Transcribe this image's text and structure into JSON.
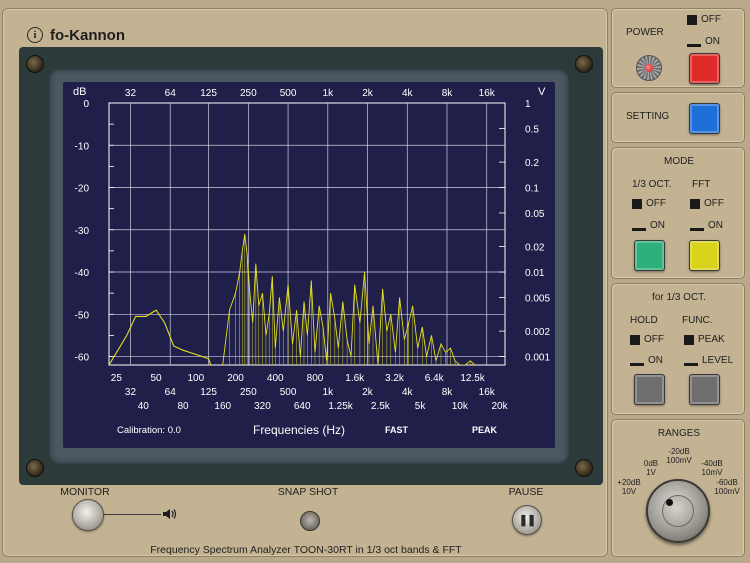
{
  "app": {
    "title": "fo-Kannon",
    "info_icon": "i"
  },
  "chart_data": {
    "type": "line",
    "title": "",
    "xlabel": "Frequencies (Hz)",
    "ylabel": "dB",
    "ylabel_right": "V",
    "ylim": [
      -62,
      0
    ],
    "x_scale": "log",
    "xlim": [
      22,
      22000
    ],
    "y_ticks_left": [
      "0",
      "-10",
      "-20",
      "-30",
      "-40",
      "-50",
      "-60"
    ],
    "y_ticks_right": [
      "1",
      "0.5",
      "0.2",
      "0.1",
      "0.05",
      "0.02",
      "0.01",
      "0.005",
      "0.002",
      "0.001"
    ],
    "x_ticks_top": [
      "32",
      "64",
      "125",
      "250",
      "500",
      "1k",
      "2k",
      "4k",
      "8k",
      "16k"
    ],
    "x_ticks_bottom_row1": [
      "25",
      "50",
      "100",
      "200",
      "400",
      "800",
      "1.6k",
      "3.2k",
      "6.4k",
      "12.5k"
    ],
    "x_ticks_bottom_row2": [
      "32",
      "64",
      "125",
      "250",
      "500",
      "1k",
      "2k",
      "4k",
      "8k",
      "16k"
    ],
    "x_ticks_bottom_row3": [
      "40",
      "80",
      "160",
      "320",
      "640",
      "1.25k",
      "2.5k",
      "5k",
      "10k",
      "20k"
    ],
    "series": [
      {
        "style": "one-third-octave",
        "x": [
          22,
          30,
          35,
          42,
          50,
          58,
          68,
          80,
          100,
          125,
          130
        ],
        "y": [
          -62,
          -55,
          -50.5,
          -50.5,
          -49,
          -52,
          -57.5,
          -58.5,
          -59.5,
          -60.5,
          -62
        ]
      },
      {
        "style": "fft-spectrum",
        "x": [
          160,
          180,
          200,
          215,
          225,
          235,
          245,
          255,
          270,
          285,
          300,
          320,
          340,
          360,
          380,
          400,
          430,
          460,
          500,
          540,
          580,
          620,
          660,
          700,
          750,
          800,
          860,
          920,
          980,
          1050,
          1130,
          1200,
          1300,
          1400,
          1500,
          1600,
          1750,
          1900,
          2050,
          2200,
          2400,
          2600,
          2800,
          3000,
          3250,
          3500,
          3800,
          4100,
          4400,
          4800,
          5200,
          5600,
          6100,
          6600,
          7200,
          7800,
          8500,
          9200,
          10000,
          11000,
          12000,
          13000
        ],
        "y": [
          -62,
          -49,
          -45,
          -40,
          -35,
          -31,
          -36,
          -44,
          -52,
          -38,
          -48,
          -45,
          -55,
          -50,
          -41,
          -58,
          -46,
          -54,
          -43,
          -57,
          -49,
          -60,
          -47,
          -55,
          -42,
          -59,
          -48,
          -53,
          -61,
          -45,
          -51,
          -58,
          -47,
          -56,
          -60,
          -43,
          -52,
          -40,
          -57,
          -48,
          -62,
          -44,
          -54,
          -50,
          -59,
          -46,
          -56,
          -52,
          -48,
          -58,
          -53,
          -60,
          -55,
          -61,
          -57,
          -59,
          -58,
          -61,
          -62,
          -62,
          -61,
          -62
        ]
      }
    ],
    "grid": true,
    "line_color": "#e6e01c",
    "background": "#1f1f4a"
  },
  "screen": {
    "calibration_label": "Calibration:",
    "calibration_value": "0.0",
    "mode_fast": "FAST",
    "mode_peak": "PEAK"
  },
  "bottom": {
    "monitor_label": "MONITOR",
    "snapshot_label": "SNAP SHOT",
    "pause_label": "PAUSE",
    "pause_icon": "pause-icon",
    "speaker_icon": "speaker-icon",
    "footer": "Frequency Spectrum Analyzer TOON-30RT   in 1/3 oct bands & FFT"
  },
  "power": {
    "label": "POWER",
    "off": "OFF",
    "on": "ON",
    "button_color": "#e02b2b"
  },
  "setting": {
    "label": "SETTING",
    "button_color": "#1f6fd8"
  },
  "mode": {
    "label": "MODE",
    "oct_label": "1/3 OCT.",
    "fft_label": "FFT",
    "off": "OFF",
    "on": "ON",
    "oct_button_color": "#2fb07a",
    "fft_button_color": "#d8d21a"
  },
  "oct_settings": {
    "label": "for 1/3 OCT.",
    "hold_label": "HOLD",
    "func_label": "FUNC.",
    "hold_off": "OFF",
    "hold_on": "ON",
    "func_peak": "PEAK",
    "func_level": "LEVEL",
    "button_color": "#6e6e6e"
  },
  "ranges": {
    "label": "RANGES",
    "positions": [
      {
        "db": "+20dB",
        "v": "10V"
      },
      {
        "db": "0dB",
        "v": "1V"
      },
      {
        "db": "-20dB",
        "v": "100mV"
      },
      {
        "db": "-40dB",
        "v": "10mV"
      },
      {
        "db": "-60dB",
        "v": "100mV"
      }
    ],
    "selected": "+20dB"
  }
}
